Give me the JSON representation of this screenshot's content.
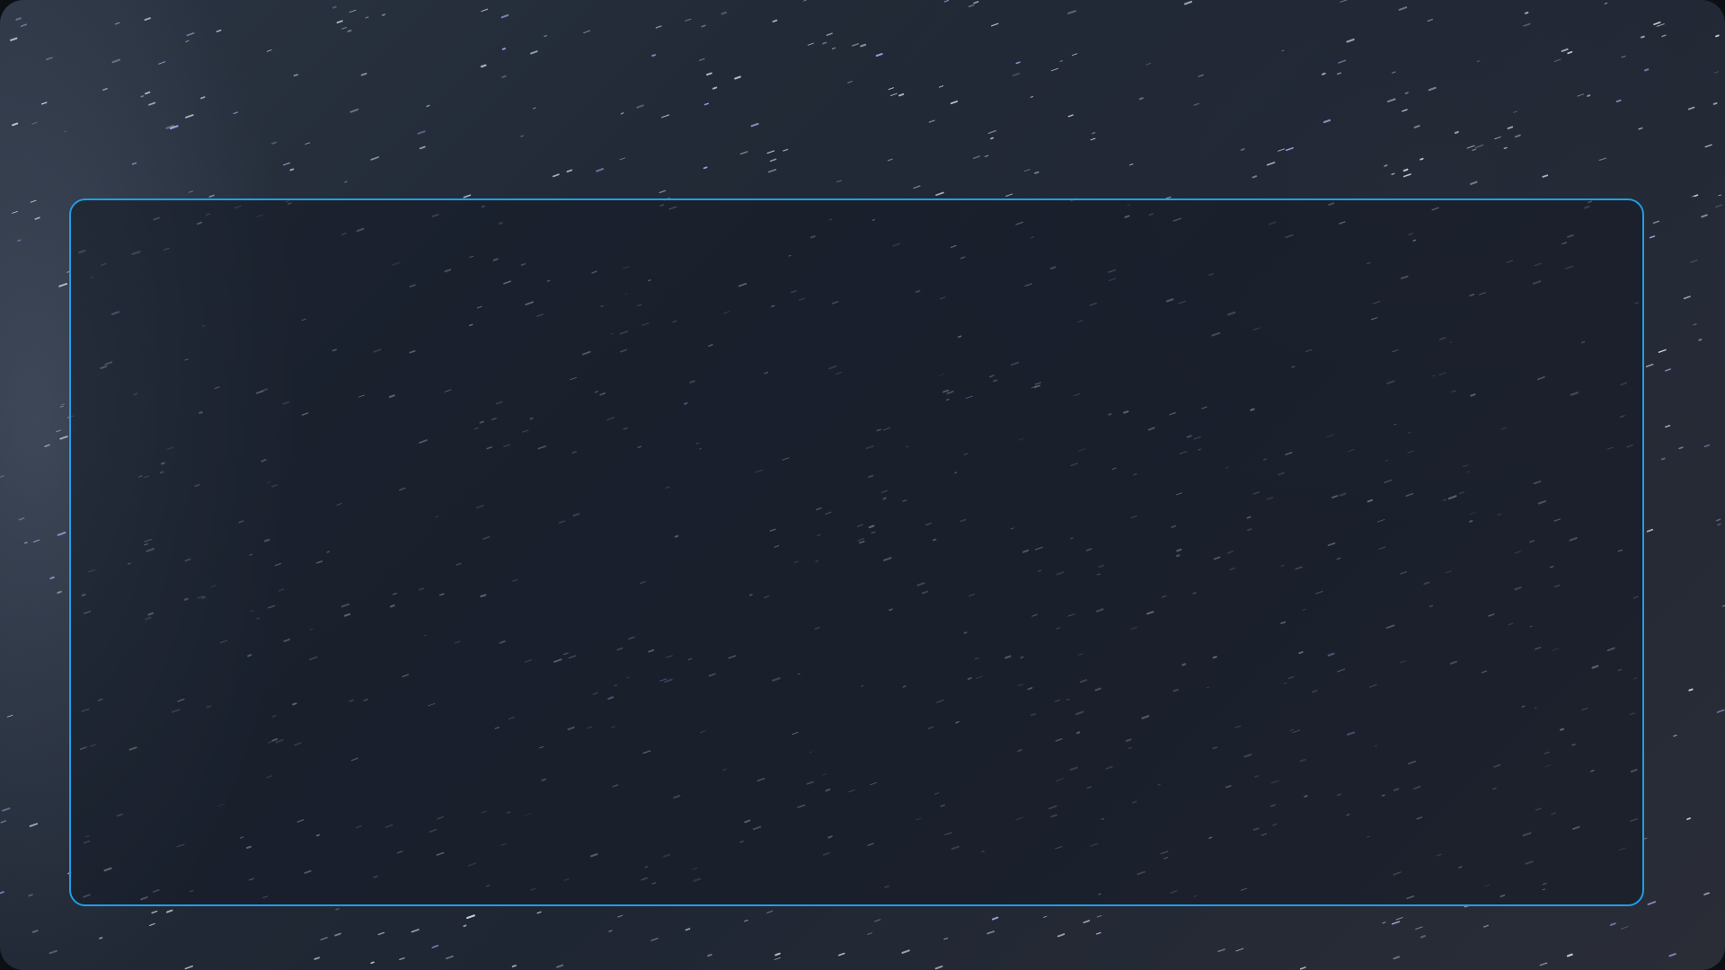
{
  "background": {
    "image": "starry-night-sky",
    "colors": {
      "sky": "#222a37",
      "milky_way_glow": "#7887a0",
      "star": "#e6e8f5",
      "star_accent": "#b9b4ff"
    }
  },
  "content_panel": {
    "state": "empty",
    "border_color": "#1f9ee6",
    "fill_color": "#141a26"
  }
}
